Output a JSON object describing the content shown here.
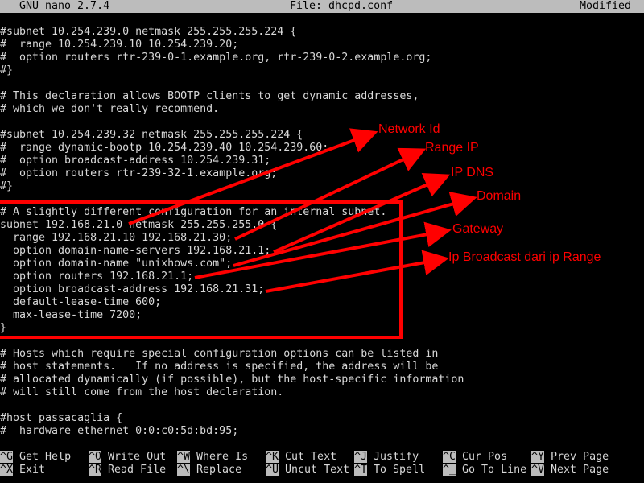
{
  "titlebar": {
    "app": "GNU nano 2.7.4",
    "file": "File: dhcpd.conf",
    "status": "Modified"
  },
  "lines": [
    "",
    "#subnet 10.254.239.0 netmask 255.255.255.224 {",
    "#  range 10.254.239.10 10.254.239.20;",
    "#  option routers rtr-239-0-1.example.org, rtr-239-0-2.example.org;",
    "#}",
    "",
    "# This declaration allows BOOTP clients to get dynamic addresses,",
    "# which we don't really recommend.",
    "",
    "#subnet 10.254.239.32 netmask 255.255.255.224 {",
    "#  range dynamic-bootp 10.254.239.40 10.254.239.60;",
    "#  option broadcast-address 10.254.239.31;",
    "#  option routers rtr-239-32-1.example.org;",
    "#}",
    "",
    "# A slightly different configuration for an internal subnet.",
    "subnet 192.168.21.0 netmask 255.255.255.0 {",
    "  range 192.168.21.10 192.168.21.30;",
    "  option domain-name-servers 192.168.21.1;",
    "  option domain-name \"unixhows.com\";",
    "  option routers 192.168.21.1;",
    "  option broadcast-address 192.168.21.31;",
    "  default-lease-time 600;",
    "  max-lease-time 7200;",
    "}",
    "",
    "# Hosts which require special configuration options can be listed in",
    "# host statements.   If no address is specified, the address will be",
    "# allocated dynamically (if possible), but the host-specific information",
    "# will still come from the host declaration.",
    "",
    "#host passacaglia {",
    "#  hardware ethernet 0:0:c0:5d:bd:95;"
  ],
  "shortcuts": [
    {
      "key": "^G",
      "label": "Get Help"
    },
    {
      "key": "^O",
      "label": "Write Out"
    },
    {
      "key": "^W",
      "label": "Where Is"
    },
    {
      "key": "^K",
      "label": "Cut Text"
    },
    {
      "key": "^J",
      "label": "Justify"
    },
    {
      "key": "^C",
      "label": "Cur Pos"
    },
    {
      "key": "^Y",
      "label": "Prev Page"
    },
    {
      "key": "^X",
      "label": "Exit"
    },
    {
      "key": "^R",
      "label": "Read File"
    },
    {
      "key": "^\\",
      "label": "Replace"
    },
    {
      "key": "^U",
      "label": "Uncut Text"
    },
    {
      "key": "^T",
      "label": "To Spell"
    },
    {
      "key": "^_",
      "label": "Go To Line"
    },
    {
      "key": "^V",
      "label": "Next Page"
    }
  ],
  "annotations": {
    "color": "#ff0000",
    "labels": [
      "Network Id",
      "Range IP",
      "IP DNS",
      "Domain",
      "Gateway",
      "Ip Broadcast dari ip Range"
    ]
  }
}
